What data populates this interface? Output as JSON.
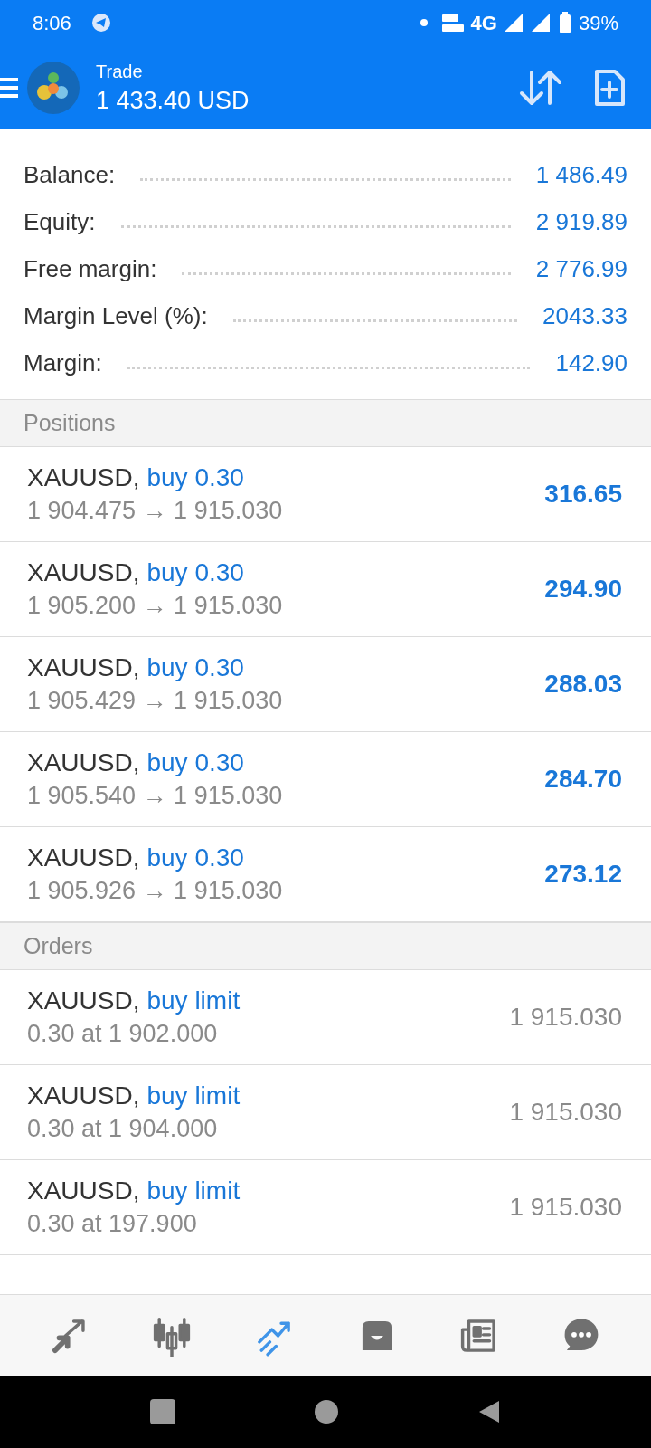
{
  "status_bar": {
    "time": "8:06",
    "network": "4G",
    "battery": "39%"
  },
  "header": {
    "title": "Trade",
    "amount": "1 433.40 USD"
  },
  "summary": [
    {
      "label": "Balance:",
      "value": "1 486.49"
    },
    {
      "label": "Equity:",
      "value": "2 919.89"
    },
    {
      "label": "Free margin:",
      "value": "2 776.99"
    },
    {
      "label": "Margin Level (%):",
      "value": "2043.33"
    },
    {
      "label": "Margin:",
      "value": "142.90"
    }
  ],
  "positions": {
    "title": "Positions",
    "items": [
      {
        "symbol": "XAUUSD,",
        "side": "buy 0.30",
        "prices": "1 904.475 → 1 915.030",
        "profit": "316.65"
      },
      {
        "symbol": "XAUUSD,",
        "side": "buy 0.30",
        "prices": "1 905.200 → 1 915.030",
        "profit": "294.90"
      },
      {
        "symbol": "XAUUSD,",
        "side": "buy 0.30",
        "prices": "1 905.429 → 1 915.030",
        "profit": "288.03"
      },
      {
        "symbol": "XAUUSD,",
        "side": "buy 0.30",
        "prices": "1 905.540 → 1 915.030",
        "profit": "284.70"
      },
      {
        "symbol": "XAUUSD,",
        "side": "buy 0.30",
        "prices": "1 905.926 → 1 915.030",
        "profit": "273.12"
      }
    ]
  },
  "orders": {
    "title": "Orders",
    "items": [
      {
        "symbol": "XAUUSD,",
        "side": "buy limit",
        "detail": "0.30 at 1 902.000",
        "price": "1 915.030"
      },
      {
        "symbol": "XAUUSD,",
        "side": "buy limit",
        "detail": "0.30 at 1 904.000",
        "price": "1 915.030"
      },
      {
        "symbol": "XAUUSD,",
        "side": "buy limit",
        "detail": "0.30 at 197.900",
        "price": "1 915.030"
      }
    ]
  },
  "bottom_nav": [
    {
      "selected": false
    },
    {
      "selected": false
    },
    {
      "selected": true
    },
    {
      "selected": false
    },
    {
      "selected": false
    },
    {
      "selected": false
    }
  ]
}
